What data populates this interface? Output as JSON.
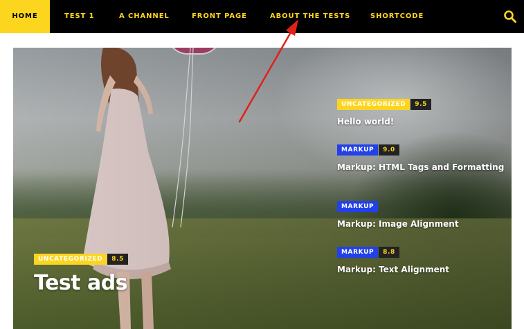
{
  "nav": {
    "items": [
      {
        "label": "HOME",
        "active": true
      },
      {
        "label": "TEST 1",
        "active": false
      },
      {
        "label": "A CHANNEL",
        "active": false
      },
      {
        "label": "FRONT PAGE",
        "active": false
      },
      {
        "label": "ABOUT THE TESTS",
        "active": false
      },
      {
        "label": "SHORTCODE",
        "active": false
      }
    ],
    "search_icon": "search-icon"
  },
  "colors": {
    "accent_yellow": "#fcd51e",
    "category_blue": "#2241e8",
    "nav_background": "#000000",
    "annotation_arrow": "#e0201a"
  },
  "featured": {
    "category": "UNCATEGORIZED",
    "score": "8.5",
    "title": "Test ads"
  },
  "side_posts": [
    {
      "category": "UNCATEGORIZED",
      "category_color": "yellow",
      "score": "9.5",
      "title": "Hello world!"
    },
    {
      "category": "MARKUP",
      "category_color": "blue",
      "score": "9.0",
      "title": "Markup: HTML Tags and Formatting"
    },
    {
      "category": "MARKUP",
      "category_color": "blue",
      "score": null,
      "title": "Markup: Image Alignment"
    },
    {
      "category": "MARKUP",
      "category_color": "blue",
      "score": "8.8",
      "title": "Markup: Text Alignment"
    }
  ]
}
